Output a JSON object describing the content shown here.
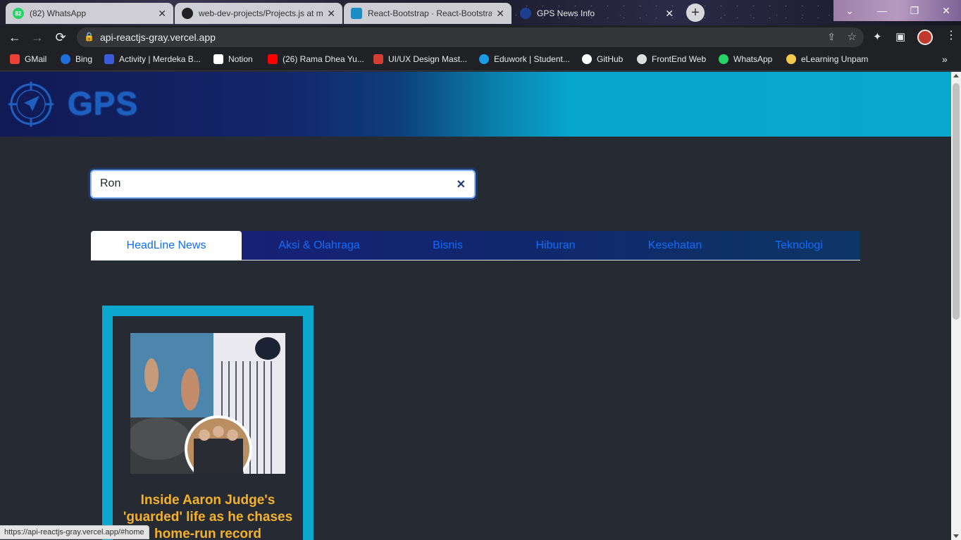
{
  "browser": {
    "tabs": [
      {
        "title": "(82) WhatsApp",
        "favicon": "whatsapp-icon",
        "badge": "82",
        "color": "#25d366"
      },
      {
        "title": "web-dev-projects/Projects.js at m",
        "favicon": "github-icon",
        "color": "#222222"
      },
      {
        "title": "React-Bootstrap · React-Bootstrap",
        "favicon": "react-bootstrap-icon",
        "color": "#1b8ec6"
      },
      {
        "title": "GPS News Info",
        "favicon": "gps-icon",
        "color": "#1d5fbf"
      }
    ],
    "new_tab": "+",
    "window_controls": {
      "dropdown": "⌄",
      "minimize": "—",
      "restore": "❐",
      "close": "✕"
    },
    "url": "api-reactjs-gray.vercel.app",
    "bookmarks": [
      {
        "label": "GMail",
        "icon": "gmail-icon",
        "color": "#ea4335"
      },
      {
        "label": "Bing",
        "icon": "search-icon",
        "color": "#1e6fd9"
      },
      {
        "label": "Activity | Merdeka B...",
        "icon": "kampus-merdeka-icon",
        "color": "#3b5bdb"
      },
      {
        "label": "Notion",
        "icon": "notion-icon",
        "color": "#ffffff"
      },
      {
        "label": "(26) Rama Dhea Yu...",
        "icon": "youtube-icon",
        "color": "#ff0000"
      },
      {
        "label": "UI/UX Design Mast...",
        "icon": "udemy-icon",
        "color": "#d23f31"
      },
      {
        "label": "Eduwork | Student...",
        "icon": "eduwork-icon",
        "color": "#1a9be6"
      },
      {
        "label": "GitHub",
        "icon": "github-icon",
        "color": "#ffffff"
      },
      {
        "label": "FrontEnd Web",
        "icon": "frontend-web-icon",
        "color": "#dddddd"
      },
      {
        "label": "WhatsApp",
        "icon": "whatsapp-icon",
        "color": "#25d366"
      },
      {
        "label": "eLearning Unpam",
        "icon": "elearning-icon",
        "color": "#f2c94c"
      }
    ],
    "status_url": "https://api-reactjs-gray.vercel.app/#home"
  },
  "header": {
    "logo_text": "GPS"
  },
  "search": {
    "value": "Ron",
    "clear_icon": "✕"
  },
  "categories": {
    "active": "HeadLine News",
    "items": [
      "HeadLine News",
      "Aksi & Olahraga",
      "Bisnis",
      "Hiburan",
      "Kesehatan",
      "Teknologi"
    ]
  },
  "articles": [
    {
      "title": "Inside Aaron Judge's 'guarded' life as he chases home-run record",
      "image": "baseball-player-photo"
    }
  ]
}
